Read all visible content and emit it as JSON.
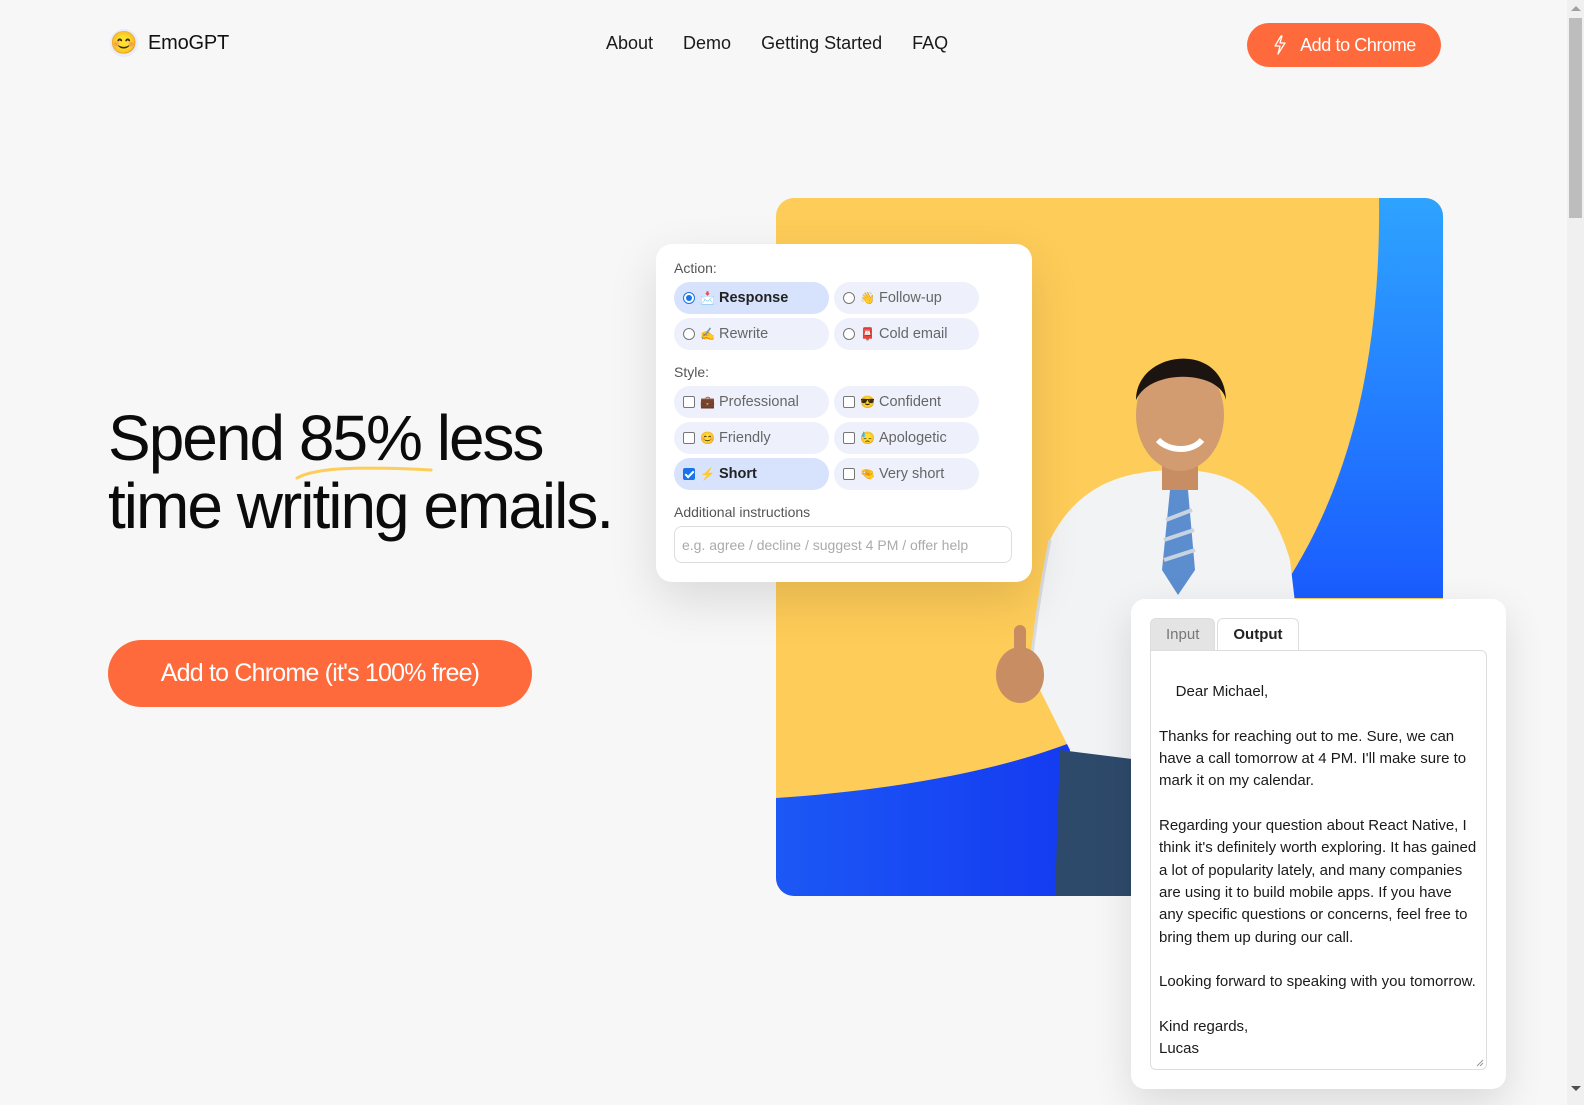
{
  "nav": {
    "logo_emoji": "😊",
    "brand": "EmoGPT",
    "links": [
      {
        "label": "About"
      },
      {
        "label": "Demo"
      },
      {
        "label": "Getting Started"
      },
      {
        "label": "FAQ"
      }
    ],
    "cta_label": "Add to Chrome",
    "cta_icon": "lightning-bolt-icon"
  },
  "hero": {
    "title_before": "Spend ",
    "title_highlight": "85%",
    "title_after": " less time writing emails.",
    "cta_label": "Add to Chrome (it's 100% free)"
  },
  "colors": {
    "accent": "#fe6a3b",
    "yellow": "#fecc58",
    "blue": "#1c4cf5",
    "selected_option": "#d7e2fc",
    "option": "#eef1fb"
  },
  "settings_panel": {
    "action_label": "Action:",
    "actions": [
      {
        "emoji": "📩",
        "label": "Response",
        "selected": true
      },
      {
        "emoji": "👋",
        "label": "Follow-up",
        "selected": false
      },
      {
        "emoji": "✍️",
        "label": "Rewrite",
        "selected": false
      },
      {
        "emoji": "📮",
        "label": "Cold email",
        "selected": false
      }
    ],
    "style_label": "Style:",
    "styles": [
      {
        "emoji": "💼",
        "label": "Professional",
        "checked": false
      },
      {
        "emoji": "😎",
        "label": "Confident",
        "checked": false
      },
      {
        "emoji": "😊",
        "label": "Friendly",
        "checked": false
      },
      {
        "emoji": "😓",
        "label": "Apologetic",
        "checked": false
      },
      {
        "emoji": "⚡",
        "label": "Short",
        "checked": true
      },
      {
        "emoji": "🤏",
        "label": "Very short",
        "checked": false
      }
    ],
    "instructions_label": "Additional instructions",
    "instructions_placeholder": "e.g. agree / decline / suggest 4 PM / offer help",
    "instructions_value": ""
  },
  "output_panel": {
    "tabs": [
      {
        "label": "Input",
        "active": false
      },
      {
        "label": "Output",
        "active": true
      }
    ],
    "output_text": "Dear Michael,\n\nThanks for reaching out to me. Sure, we can have a call tomorrow at 4 PM. I'll make sure to mark it on my calendar.\n\nRegarding your question about React Native, I think it's definitely worth exploring. It has gained a lot of popularity lately, and many companies are using it to build mobile apps. If you have any specific questions or concerns, feel free to bring them up during our call.\n\nLooking forward to speaking with you tomorrow.\n\nKind regards,\nLucas"
  }
}
